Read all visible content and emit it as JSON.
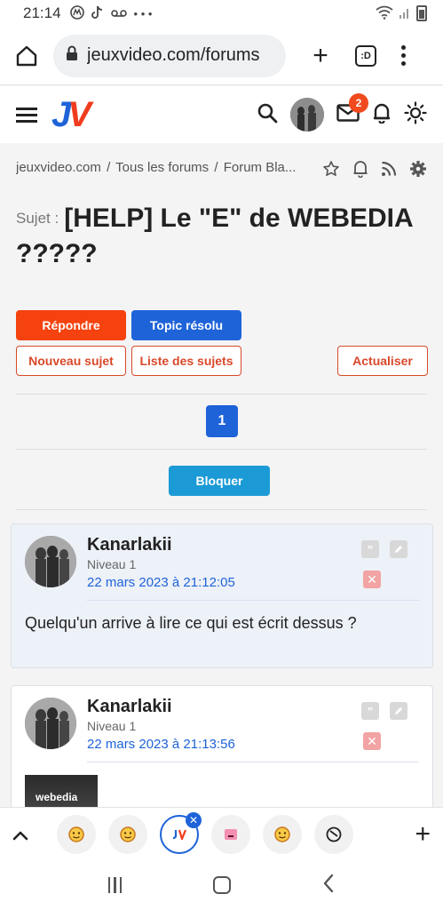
{
  "status_bar": {
    "time": "21:14",
    "icons": [
      "m-icon",
      "tiktok-icon",
      "voicemail-icon",
      "more-dots"
    ],
    "right_icons": [
      "wifi-icon",
      "signal-icon",
      "battery-icon"
    ]
  },
  "browser": {
    "url": "jeuxvideo.com/forums",
    "tabs_label": ":D"
  },
  "site": {
    "logo_j": "J",
    "logo_v": "V",
    "mail_badge": "2"
  },
  "breadcrumb": {
    "items": [
      "jeuxvideo.com",
      "Tous les forums",
      "Forum Bla..."
    ],
    "separator": "/"
  },
  "topic": {
    "prefix": "Sujet :",
    "title": "[HELP] Le \"E\" de WEBEDIA ?????"
  },
  "buttons": {
    "reply": "Répondre",
    "resolved": "Topic résolu",
    "new_topic": "Nouveau sujet",
    "topic_list": "Liste des sujets",
    "refresh": "Actualiser",
    "block": "Bloquer"
  },
  "pagination": {
    "current": "1"
  },
  "posts": [
    {
      "author": "Kanarlakii",
      "level": "Niveau 1",
      "date": "22 mars 2023 à 21:12:05",
      "body": "Quelqu'un arrive à lire ce qui est écrit dessus ?"
    },
    {
      "author": "Kanarlakii",
      "level": "Niveau 1",
      "date": "22 mars 2023 à 21:13:56",
      "image_text": "webedia"
    }
  ],
  "bottom_tabs": [
    "emoji-tab",
    "emoji-tab",
    "jv-tab-active",
    "pink-tab",
    "emoji-tab",
    "round-tab"
  ],
  "colors": {
    "accent_red": "#f5420e",
    "accent_blue": "#1e63d8",
    "block_blue": "#1b9ad6",
    "date_blue": "#1e63d8"
  }
}
